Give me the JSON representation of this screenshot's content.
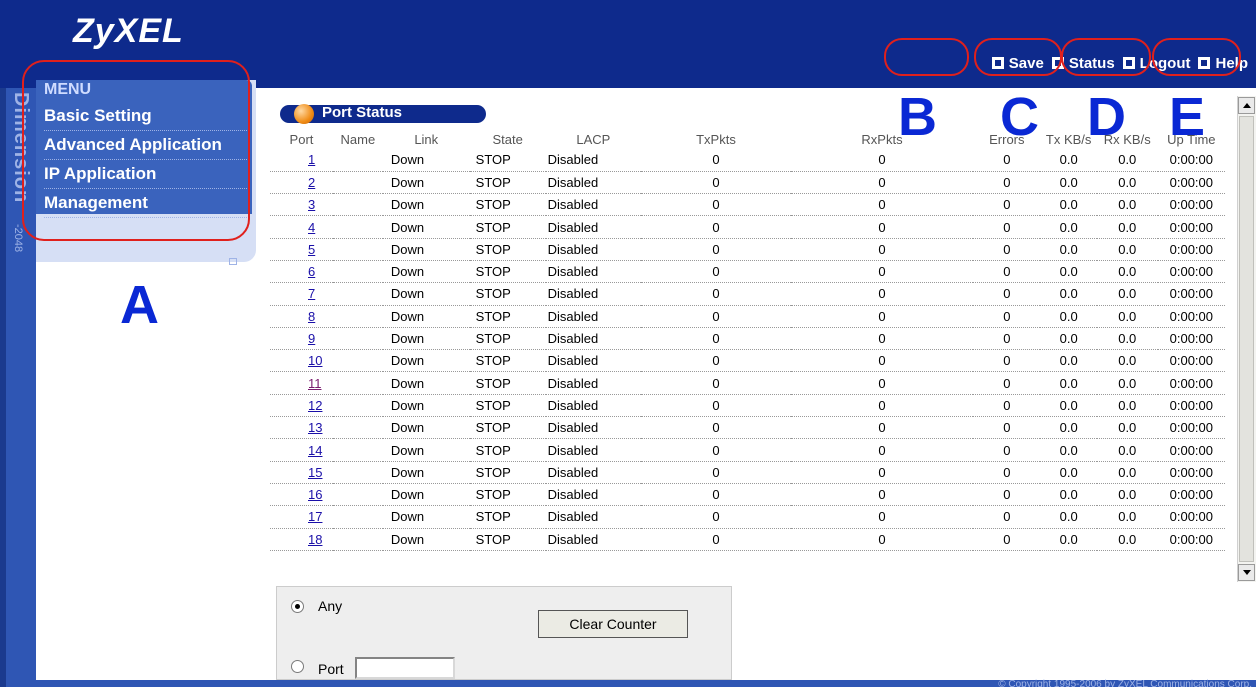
{
  "header": {
    "logo": "ZyXEL",
    "links": [
      {
        "label": "Save",
        "icon": "save-icon"
      },
      {
        "label": "Status",
        "icon": "status-icon"
      },
      {
        "label": "Logout",
        "icon": "logout-icon"
      },
      {
        "label": "Help",
        "icon": "help-icon"
      }
    ]
  },
  "sidebar": {
    "brand_text": "Dimension",
    "model_text": "-2048",
    "menu_title": "MENU",
    "items": [
      {
        "label": "Basic Setting"
      },
      {
        "label": "Advanced Application"
      },
      {
        "label": "IP Application"
      },
      {
        "label": "Management"
      }
    ]
  },
  "callouts": [
    "A",
    "B",
    "C",
    "D",
    "E"
  ],
  "port_status": {
    "title": "Port Status",
    "columns": [
      "Port",
      "Name",
      "Link",
      "State",
      "LACP",
      "TxPkts",
      "RxPkts",
      "Errors",
      "Tx KB/s",
      "Rx KB/s",
      "Up Time"
    ],
    "rows": [
      {
        "port": "1",
        "name": "",
        "link": "Down",
        "state": "STOP",
        "lacp": "Disabled",
        "txpkts": "0",
        "rxpkts": "0",
        "errors": "0",
        "tx": "0.0",
        "rx": "0.0",
        "uptime": "0:00:00"
      },
      {
        "port": "2",
        "name": "",
        "link": "Down",
        "state": "STOP",
        "lacp": "Disabled",
        "txpkts": "0",
        "rxpkts": "0",
        "errors": "0",
        "tx": "0.0",
        "rx": "0.0",
        "uptime": "0:00:00"
      },
      {
        "port": "3",
        "name": "",
        "link": "Down",
        "state": "STOP",
        "lacp": "Disabled",
        "txpkts": "0",
        "rxpkts": "0",
        "errors": "0",
        "tx": "0.0",
        "rx": "0.0",
        "uptime": "0:00:00"
      },
      {
        "port": "4",
        "name": "",
        "link": "Down",
        "state": "STOP",
        "lacp": "Disabled",
        "txpkts": "0",
        "rxpkts": "0",
        "errors": "0",
        "tx": "0.0",
        "rx": "0.0",
        "uptime": "0:00:00"
      },
      {
        "port": "5",
        "name": "",
        "link": "Down",
        "state": "STOP",
        "lacp": "Disabled",
        "txpkts": "0",
        "rxpkts": "0",
        "errors": "0",
        "tx": "0.0",
        "rx": "0.0",
        "uptime": "0:00:00"
      },
      {
        "port": "6",
        "name": "",
        "link": "Down",
        "state": "STOP",
        "lacp": "Disabled",
        "txpkts": "0",
        "rxpkts": "0",
        "errors": "0",
        "tx": "0.0",
        "rx": "0.0",
        "uptime": "0:00:00"
      },
      {
        "port": "7",
        "name": "",
        "link": "Down",
        "state": "STOP",
        "lacp": "Disabled",
        "txpkts": "0",
        "rxpkts": "0",
        "errors": "0",
        "tx": "0.0",
        "rx": "0.0",
        "uptime": "0:00:00"
      },
      {
        "port": "8",
        "name": "",
        "link": "Down",
        "state": "STOP",
        "lacp": "Disabled",
        "txpkts": "0",
        "rxpkts": "0",
        "errors": "0",
        "tx": "0.0",
        "rx": "0.0",
        "uptime": "0:00:00"
      },
      {
        "port": "9",
        "name": "",
        "link": "Down",
        "state": "STOP",
        "lacp": "Disabled",
        "txpkts": "0",
        "rxpkts": "0",
        "errors": "0",
        "tx": "0.0",
        "rx": "0.0",
        "uptime": "0:00:00"
      },
      {
        "port": "10",
        "name": "",
        "link": "Down",
        "state": "STOP",
        "lacp": "Disabled",
        "txpkts": "0",
        "rxpkts": "0",
        "errors": "0",
        "tx": "0.0",
        "rx": "0.0",
        "uptime": "0:00:00"
      },
      {
        "port": "11",
        "name": "",
        "link": "Down",
        "state": "STOP",
        "lacp": "Disabled",
        "txpkts": "0",
        "rxpkts": "0",
        "errors": "0",
        "tx": "0.0",
        "rx": "0.0",
        "uptime": "0:00:00"
      },
      {
        "port": "12",
        "name": "",
        "link": "Down",
        "state": "STOP",
        "lacp": "Disabled",
        "txpkts": "0",
        "rxpkts": "0",
        "errors": "0",
        "tx": "0.0",
        "rx": "0.0",
        "uptime": "0:00:00"
      },
      {
        "port": "13",
        "name": "",
        "link": "Down",
        "state": "STOP",
        "lacp": "Disabled",
        "txpkts": "0",
        "rxpkts": "0",
        "errors": "0",
        "tx": "0.0",
        "rx": "0.0",
        "uptime": "0:00:00"
      },
      {
        "port": "14",
        "name": "",
        "link": "Down",
        "state": "STOP",
        "lacp": "Disabled",
        "txpkts": "0",
        "rxpkts": "0",
        "errors": "0",
        "tx": "0.0",
        "rx": "0.0",
        "uptime": "0:00:00"
      },
      {
        "port": "15",
        "name": "",
        "link": "Down",
        "state": "STOP",
        "lacp": "Disabled",
        "txpkts": "0",
        "rxpkts": "0",
        "errors": "0",
        "tx": "0.0",
        "rx": "0.0",
        "uptime": "0:00:00"
      },
      {
        "port": "16",
        "name": "",
        "link": "Down",
        "state": "STOP",
        "lacp": "Disabled",
        "txpkts": "0",
        "rxpkts": "0",
        "errors": "0",
        "tx": "0.0",
        "rx": "0.0",
        "uptime": "0:00:00"
      },
      {
        "port": "17",
        "name": "",
        "link": "Down",
        "state": "STOP",
        "lacp": "Disabled",
        "txpkts": "0",
        "rxpkts": "0",
        "errors": "0",
        "tx": "0.0",
        "rx": "0.0",
        "uptime": "0:00:00"
      },
      {
        "port": "18",
        "name": "",
        "link": "Down",
        "state": "STOP",
        "lacp": "Disabled",
        "txpkts": "0",
        "rxpkts": "0",
        "errors": "0",
        "tx": "0.0",
        "rx": "0.0",
        "uptime": "0:00:00"
      }
    ]
  },
  "form": {
    "radio_any_label": "Any",
    "radio_port_label": "Port",
    "port_value": "",
    "clear_button_label": "Clear Counter"
  },
  "footer": {
    "copyright": "© Copyright 1995-2006 by ZyXEL Communications Corp."
  },
  "colors": {
    "banner": "#0e2a8c",
    "menu": "#3a63bd",
    "callout": "#0a28d4",
    "ring": "#e0201c"
  }
}
